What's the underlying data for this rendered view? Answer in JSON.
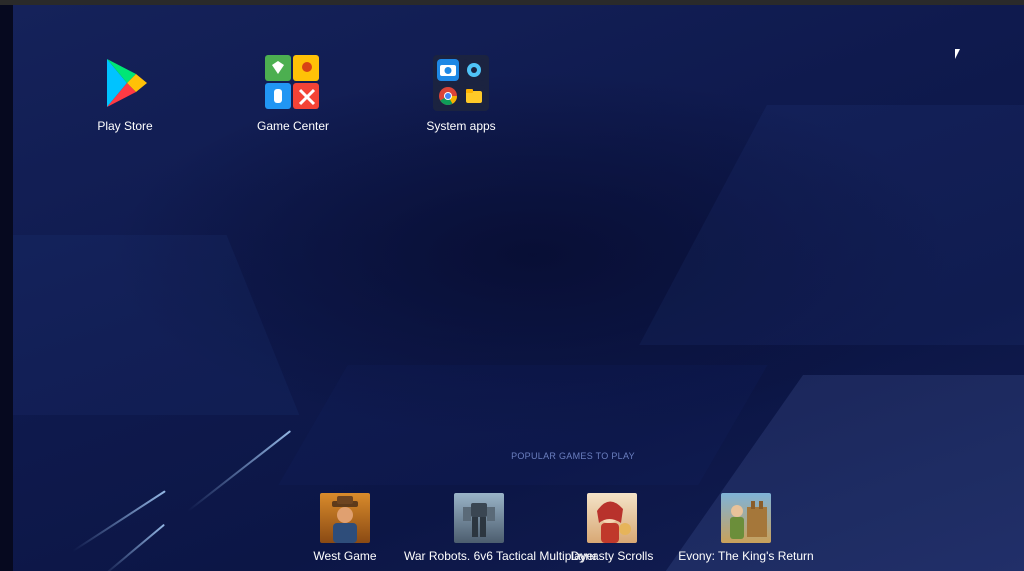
{
  "desktop_apps": [
    {
      "label": "Play Store",
      "icon": "play-store-icon"
    },
    {
      "label": "Game Center",
      "icon": "game-center-icon"
    },
    {
      "label": "System apps",
      "icon": "system-apps-folder-icon"
    }
  ],
  "popular": {
    "title": "POPULAR GAMES TO PLAY",
    "games": [
      {
        "label": "West Game",
        "icon": "west-game-icon"
      },
      {
        "label": "War Robots. 6v6 Tactical Multiplayer",
        "icon": "war-robots-icon"
      },
      {
        "label": "Dynasty Scrolls",
        "icon": "dynasty-scrolls-icon"
      },
      {
        "label": "Evony: The King's Return",
        "icon": "evony-icon"
      }
    ]
  },
  "colors": {
    "background": "#0d1540",
    "section_title": "#6b7fc0",
    "label": "#ffffff"
  }
}
